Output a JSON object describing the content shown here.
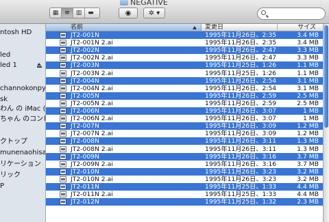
{
  "window": {
    "title": "NEGATIVE"
  },
  "toolbar": {
    "view_icons_glyph": "▦",
    "view_list_glyph": "≡",
    "view_columns_glyph": "▥",
    "view_coverflow_glyph": "▬",
    "quicklook_glyph": "◉",
    "action_glyph": "✲ ▾",
    "search_placeholder": ""
  },
  "sidebar": {
    "items": [
      {
        "label": "ntosh HD"
      },
      {
        "label": ""
      },
      {
        "label": "led"
      },
      {
        "label": "led 1"
      },
      {
        "label": ""
      },
      {
        "label": "channokonpy"
      },
      {
        "label": "sk"
      },
      {
        "label": "わん の iMac (10)"
      },
      {
        "label": "ちゃん のコンピ…"
      },
      {
        "label": ""
      },
      {
        "label": "クトップ"
      },
      {
        "label": "munenaohisa"
      },
      {
        "label": "リケーション"
      },
      {
        "label": "リック"
      },
      {
        "label": "P"
      }
    ]
  },
  "list": {
    "columns": {
      "name": "名前",
      "date": "変更日",
      "size": "サイズ"
    },
    "rows": [
      {
        "name": "JT2-001N",
        "date": "1995年11月26日、2:35",
        "size": "3.4 MB",
        "selected": true
      },
      {
        "name": "JT2-001N 2.ai",
        "date": "1995年11月26日、2:35",
        "size": "3.4 MB",
        "selected": false
      },
      {
        "name": "JT2-002N",
        "date": "1995年11月26日、2:47",
        "size": "3.3 MB",
        "selected": true
      },
      {
        "name": "JT2-002N 2.ai",
        "date": "1995年11月26日、2:47",
        "size": "3.3 MB",
        "selected": false
      },
      {
        "name": "JT2-003N",
        "date": "1995年11月25日、1:26",
        "size": "1.1 MB",
        "selected": true
      },
      {
        "name": "JT2-003N 2.ai",
        "date": "1995年11月25日、1:26",
        "size": "1.1 MB",
        "selected": false
      },
      {
        "name": "JT2-004N",
        "date": "1995年11月26日、2:54",
        "size": "3.1 MB",
        "selected": true
      },
      {
        "name": "JT2-004N 2.ai",
        "date": "1995年11月26日、2:54",
        "size": "3.1 MB",
        "selected": false
      },
      {
        "name": "JT2-005N",
        "date": "1995年11月26日、2:59",
        "size": "2.5 MB",
        "selected": true
      },
      {
        "name": "JT2-005N 2.ai",
        "date": "1995年11月26日、2:59",
        "size": "2.5 MB",
        "selected": false
      },
      {
        "name": "JT2-006N",
        "date": "1995年11月26日、3:07",
        "size": "1 MB",
        "selected": true
      },
      {
        "name": "JT2-006N 2.ai",
        "date": "1995年11月26日、3:07",
        "size": "1 MB",
        "selected": false
      },
      {
        "name": "JT2-007N",
        "date": "1995年11月26日、3:09",
        "size": "1.2 MB",
        "selected": true
      },
      {
        "name": "JT2-007N 2.ai",
        "date": "1995年11月26日、3:09",
        "size": "1.2 MB",
        "selected": false
      },
      {
        "name": "JT2-008N",
        "date": "1995年11月26日、3:11",
        "size": "1.3 MB",
        "selected": true
      },
      {
        "name": "JT2-008N 2.ai",
        "date": "1995年11月26日、3:11",
        "size": "1.3 MB",
        "selected": false
      },
      {
        "name": "JT2-009N",
        "date": "1995年11月26日、3:16",
        "size": "3.7 MB",
        "selected": true
      },
      {
        "name": "JT2-009N 2.ai",
        "date": "1995年11月26日、3:16",
        "size": "3.7 MB",
        "selected": false
      },
      {
        "name": "JT2-010N",
        "date": "1995年11月26日、3:23",
        "size": "3.2 MB",
        "selected": true
      },
      {
        "name": "JT2-010N 2.ai",
        "date": "1995年11月26日、3:23",
        "size": "3.2 MB",
        "selected": false
      },
      {
        "name": "JT2-011N",
        "date": "1995年11月25日、1:33",
        "size": "4.4 MB",
        "selected": true
      },
      {
        "name": "JT2-011N 2.ai",
        "date": "1995年11月25日、1:33",
        "size": "4.4 MB",
        "selected": false
      },
      {
        "name": "JT2-012N",
        "date": "1995年11月25日、1:32",
        "size": "2.3 MB",
        "selected": true
      }
    ]
  },
  "colors": {
    "selection": "#3875d7",
    "sidebar_bg": "#dde4ec",
    "header_sorted": "#9ebde0"
  }
}
